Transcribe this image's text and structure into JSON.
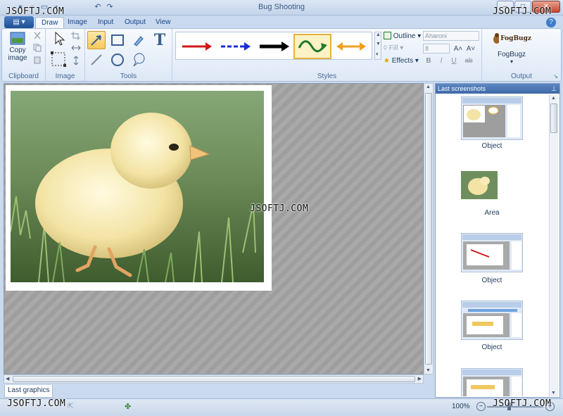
{
  "window": {
    "title": "Bug Shooting",
    "minimize_label": "–",
    "maximize_label": "□",
    "close_label": "✕"
  },
  "watermarks": {
    "text": "JSOFTJ.COM"
  },
  "tabs": [
    {
      "label": "Draw",
      "active": true
    },
    {
      "label": "Image"
    },
    {
      "label": "Input"
    },
    {
      "label": "Output"
    },
    {
      "label": "View"
    }
  ],
  "help": {
    "label": "?"
  },
  "ribbon": {
    "clipboard": {
      "label": "Clipboard",
      "copy_image_label": "Copy image"
    },
    "image": {
      "label": "Image"
    },
    "tools": {
      "label": "Tools",
      "text_tool_glyph": "T"
    },
    "styles": {
      "label": "Styles",
      "outline_label": "Outline",
      "fill_label": "Fill",
      "effects_label": "Effects",
      "font_value": "Aharoni",
      "size_value": "8",
      "bold": "B",
      "italic": "I",
      "underline": "U",
      "strike": "ab",
      "grow": "A˄",
      "shrink": "A˅",
      "arrow_colors": [
        "#d01818",
        "#1a2ed6",
        "#000000",
        "#1f7a24",
        "#f0a020"
      ]
    },
    "output": {
      "label": "Output",
      "fogbugz_logo": "FogBugz",
      "fogbugz_label": "FogBugz"
    }
  },
  "bottom_tabs": {
    "last_graphics": "Last graphics"
  },
  "panel": {
    "title": "Last screenshots",
    "items": [
      {
        "label": "Object"
      },
      {
        "label": "Area"
      },
      {
        "label": "Object"
      },
      {
        "label": "Object"
      },
      {
        "label": ""
      }
    ]
  },
  "status": {
    "zoom": "100%",
    "zoom_minus": "−",
    "zoom_plus": "+"
  }
}
